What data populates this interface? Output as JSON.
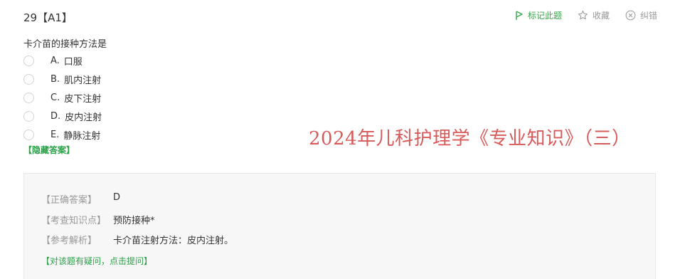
{
  "question": {
    "number": "29【A1】",
    "stem": "卡介苗的接种方法是",
    "options": [
      {
        "letter": "A.",
        "text": "口服"
      },
      {
        "letter": "B.",
        "text": "肌内注射"
      },
      {
        "letter": "C.",
        "text": "皮下注射"
      },
      {
        "letter": "D.",
        "text": "皮内注射"
      },
      {
        "letter": "E.",
        "text": "静脉注射"
      }
    ],
    "hide_answer": "【隐藏答案】"
  },
  "actions": {
    "mark": "标记此题",
    "favorite": "收藏",
    "report": "纠错"
  },
  "watermark": "2024年儿科护理学《专业知识》（三）",
  "answer_panel": {
    "correct_label": "【正确答案】",
    "correct_value": "D",
    "knowledge_label": "【考查知识点】",
    "knowledge_value": "预防接种*",
    "analysis_label": "【参考解析】",
    "analysis_value": "卡介苗注射方法：皮内注射。",
    "ask_link": "【对该题有疑问，点击提问】"
  },
  "colors": {
    "accent_green": "#2aa047",
    "watermark_red": "#d85a5a",
    "muted": "#999999"
  }
}
